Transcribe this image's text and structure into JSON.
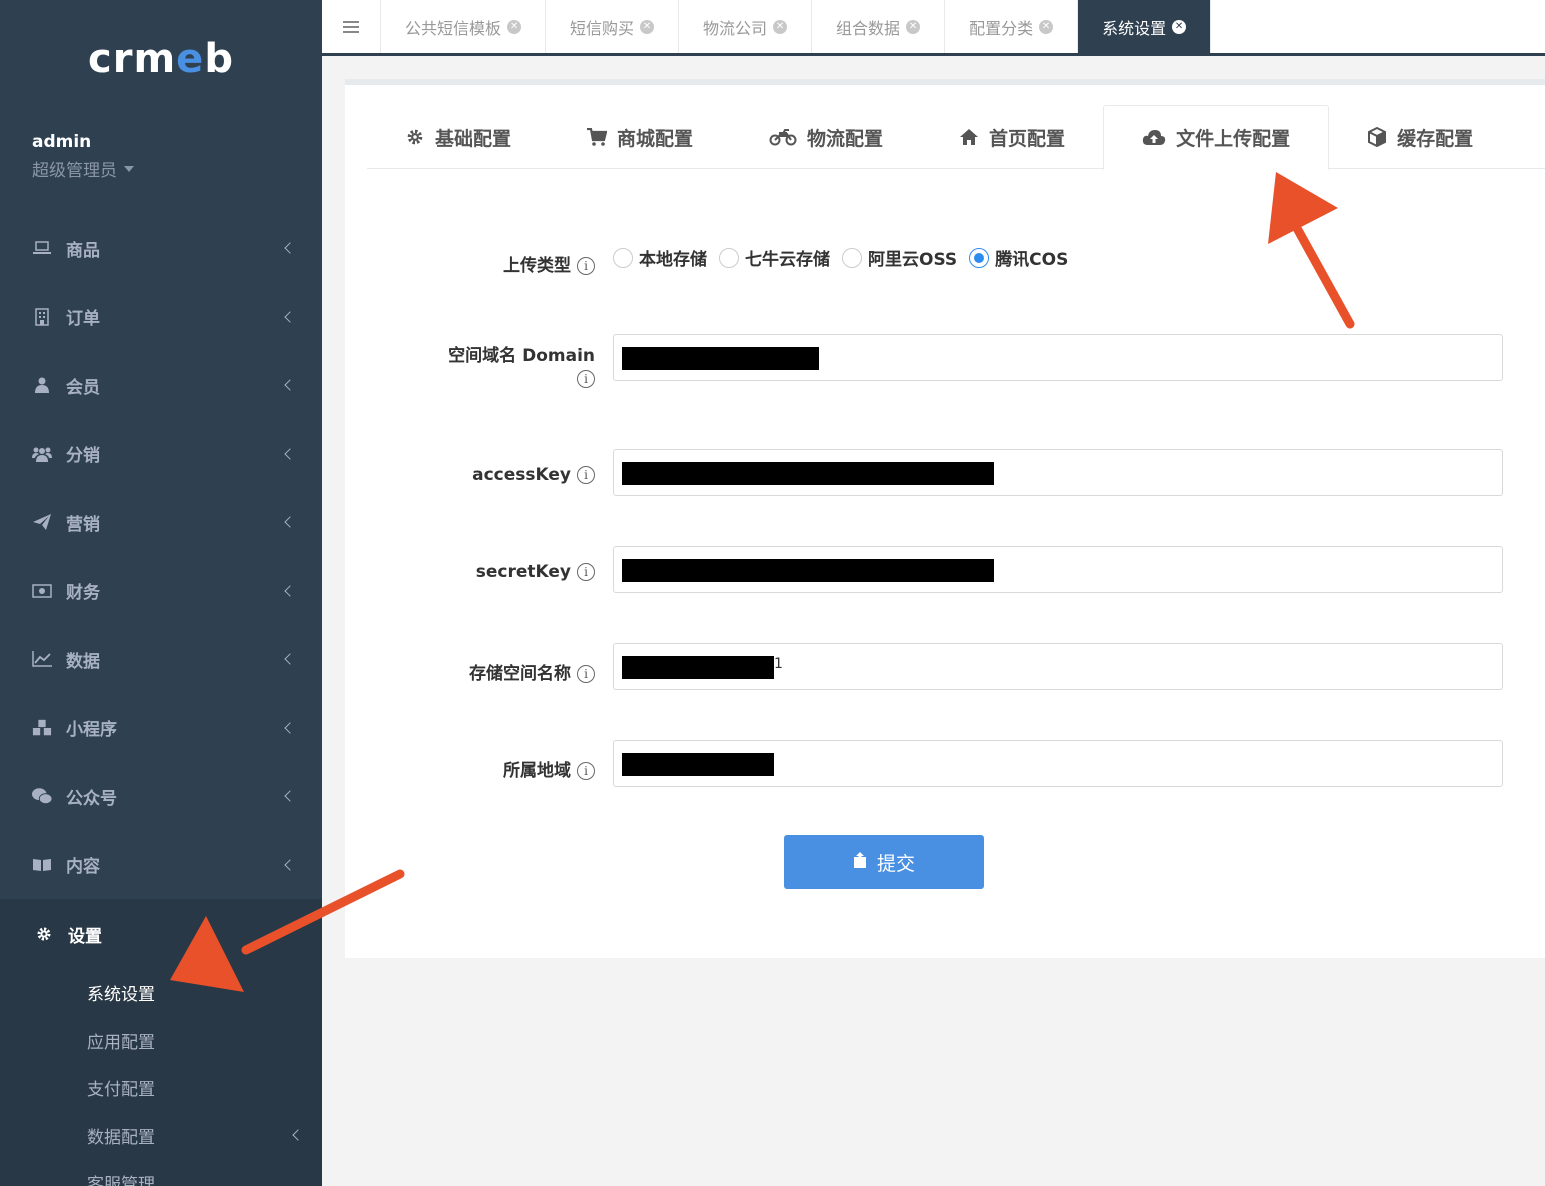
{
  "logo": {
    "text_part1": "crm",
    "text_part2": "e",
    "text_part3": "b"
  },
  "profile": {
    "username": "admin",
    "role": "超级管理员"
  },
  "sidebar": {
    "items": [
      {
        "label": "商品",
        "icon": "laptop-icon"
      },
      {
        "label": "订单",
        "icon": "building-icon"
      },
      {
        "label": "会员",
        "icon": "user-icon"
      },
      {
        "label": "分销",
        "icon": "users-icon"
      },
      {
        "label": "营销",
        "icon": "paper-plane-icon"
      },
      {
        "label": "财务",
        "icon": "money-icon"
      },
      {
        "label": "数据",
        "icon": "line-chart-icon"
      },
      {
        "label": "小程序",
        "icon": "cubes-icon"
      },
      {
        "label": "公众号",
        "icon": "wechat-icon"
      },
      {
        "label": "内容",
        "icon": "book-icon"
      }
    ],
    "active": {
      "label": "设置",
      "sub": [
        {
          "label": "系统设置"
        },
        {
          "label": "应用配置"
        },
        {
          "label": "支付配置"
        },
        {
          "label": "数据配置"
        },
        {
          "label": "客服管理"
        }
      ]
    }
  },
  "page_tabs": [
    "公共短信模板",
    "短信购买",
    "物流公司",
    "组合数据",
    "配置分类",
    "系统设置"
  ],
  "config_tabs": [
    {
      "label": "基础配置",
      "icon": "gear-icon"
    },
    {
      "label": "商城配置",
      "icon": "cart-icon"
    },
    {
      "label": "物流配置",
      "icon": "motorcycle-icon"
    },
    {
      "label": "首页配置",
      "icon": "home-icon"
    },
    {
      "label": "文件上传配置",
      "icon": "cloud-upload-icon"
    },
    {
      "label": "缓存配置",
      "icon": "cube-icon"
    }
  ],
  "form": {
    "upload_type": {
      "label": "上传类型",
      "options": [
        "本地存储",
        "七牛云存储",
        "阿里云OSS",
        "腾讯COS"
      ],
      "selected": "腾讯COS"
    },
    "domain": {
      "label": "空间域名 Domain"
    },
    "access_key": {
      "label": "accessKey"
    },
    "secret_key": {
      "label": "secretKey"
    },
    "bucket": {
      "label": "存储空间名称",
      "visible_tail": "1"
    },
    "region": {
      "label": "所属地域"
    },
    "submit_label": "提交"
  },
  "colors": {
    "sidebar_bg": "#2f4050",
    "primary": "#4a90e2",
    "arrow": "#e8512a",
    "radio_selected": "#2d8cf0"
  }
}
